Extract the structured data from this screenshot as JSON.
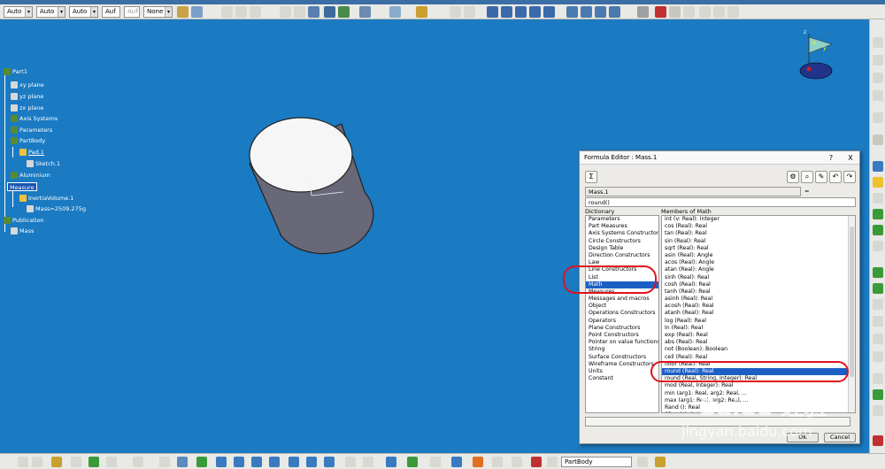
{
  "toolbar": {
    "combos": [
      "Auto",
      "Auto",
      "Auto",
      "Auf",
      "Auf",
      "None"
    ]
  },
  "tree": {
    "items": [
      "Part1",
      "xy plane",
      "yz plane",
      "zx plane",
      "Axis Systems",
      "Parameters",
      "PartBody",
      "Pad.1",
      "Sketch.1",
      "Aluminium",
      "Measure",
      "InertiaVolume.1",
      "Mass=2509.275g",
      "Publication",
      "Mass"
    ]
  },
  "compass": {
    "x": "x",
    "y": "y",
    "z": "z"
  },
  "dialog": {
    "title": "Formula Editor : Mass.1",
    "help": "?",
    "close": "X",
    "param_name": "Mass.1",
    "equals": "=",
    "formula": "round()",
    "dictionary_header": "Dictionary",
    "members_header": "Members of Math",
    "dictionary": [
      "Parameters",
      "Part Measures",
      "Axis Systems Constructors",
      "Circle Constructors",
      "Design Table",
      "Direction Constructors",
      "Law",
      "Line Constructors",
      "List",
      "Math",
      "Measures",
      "Messages and macros",
      "Object",
      "Operations Constructors",
      "Operators",
      "Plane Constructors",
      "Point Constructors",
      "Pointer on value functions",
      "String",
      "Surface Constructors",
      "Wireframe Constructors",
      "Units",
      "Constant"
    ],
    "dictionary_selected": 9,
    "members": [
      "int (v: Real): Integer",
      "cos (Real): Real",
      "tan (Real): Real",
      "sin (Real): Real",
      "sqrt (Real): Real",
      "asin (Real): Angle",
      "acos (Real): Angle",
      "atan (Real): Angle",
      "sinh (Real): Real",
      "cosh (Real): Real",
      "tanh (Real): Real",
      "asinh (Real): Real",
      "acosh (Real): Real",
      "atanh (Real): Real",
      "log (Real): Real",
      "ln (Real): Real",
      "exp (Real): Real",
      "abs (Real): Real",
      "not (Boolean): Boolean",
      "ceil (Real): Real",
      "floor (Real): Real",
      "round (Real): Real",
      "round (Real, String, Integer): Real",
      "mod (Real, Integer): Real",
      "min (arg1: Real, arg2: Real, ...",
      "max (arg1: Real, arg2: Real, ...",
      "Rand (): Real",
      "SRand (...): Integer"
    ],
    "members_selected": 21,
    "ok": "OK",
    "cancel": "Cancel"
  },
  "status": {
    "body_combo": "PartBody"
  },
  "watermark": {
    "brand": "Baidu 经验",
    "url": "jingyan.baidu.com"
  },
  "colors": {
    "background": "#1a7ac2",
    "selection": "#1c5fc4",
    "annotation": "#e0121e"
  }
}
